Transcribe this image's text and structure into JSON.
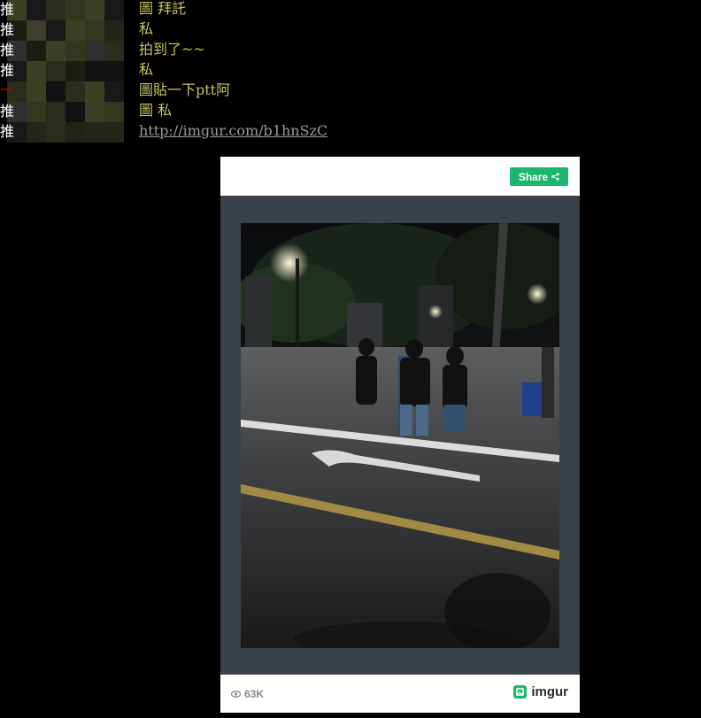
{
  "comments": [
    {
      "tag": "推",
      "text": "圖 拜託"
    },
    {
      "tag": "推",
      "text": "私"
    },
    {
      "tag": "推",
      "text": "拍到了~~"
    },
    {
      "tag": "推",
      "text": "私"
    },
    {
      "tag": "→",
      "text": "圖貼一下ptt阿"
    },
    {
      "tag": "推",
      "text": "圖 私"
    },
    {
      "tag": "推",
      "link": "http://imgur.com/b1hnSzC"
    }
  ],
  "embed": {
    "share_label": "Share",
    "views": "63K",
    "brand": "imgur",
    "photo_icon": "street-night-photo"
  },
  "colors": {
    "push_text": "#c8c45e",
    "share_green": "#1bb76e",
    "embed_bg": "#3b4149"
  }
}
